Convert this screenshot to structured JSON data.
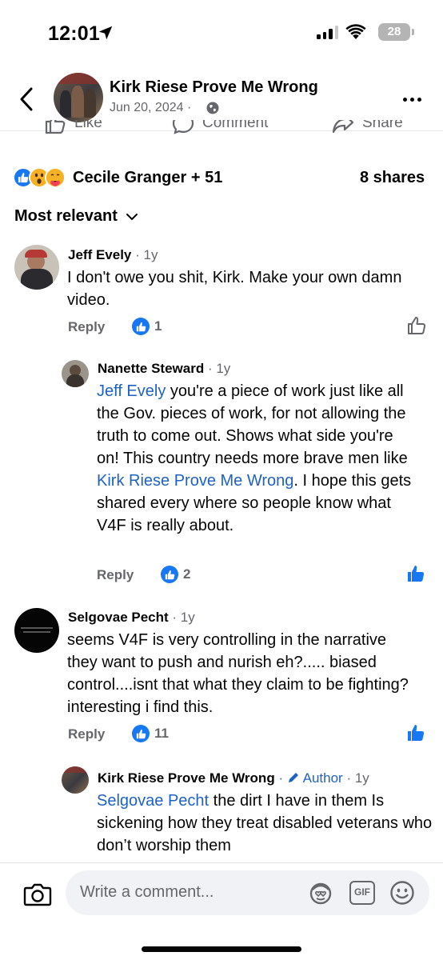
{
  "status": {
    "time": "12:01",
    "battery": "28"
  },
  "header": {
    "title": "Kirk Riese Prove Me Wrong",
    "date": "Jun 20, 2024",
    "date_separator": "·"
  },
  "actions": {
    "like": "Like",
    "comment": "Comment",
    "share": "Share"
  },
  "reactions": {
    "reactors": "Cecile Granger + 51",
    "shares": "8 shares"
  },
  "sort": {
    "label": "Most relevant"
  },
  "comments": [
    {
      "name": "Jeff Evely",
      "time": "· 1y",
      "text": "I don't owe you shit, Kirk. Make your own damn video.",
      "reply": "Reply",
      "likes": "1"
    },
    {
      "name": "Nanette Steward",
      "time": "· 1y",
      "mention1": "Jeff Evely",
      "text1": " you're a piece of work just like all the Gov. pieces of work,  for not allowing the truth to come out. Shows what side you're on! This country needs more brave men like ",
      "mention2": "Kirk Riese Prove Me Wrong",
      "text2": ". I hope this gets shared every where so people know what V4F is really about.",
      "reply": "Reply",
      "likes": "2"
    },
    {
      "name": "Selgovae Pecht",
      "time": "· 1y",
      "text": "seems V4F is very controlling in the narrative they want to push and nurish eh?..... biased control....isnt that what they claim to be fighting? interesting i find this.",
      "reply": "Reply",
      "likes": "11"
    },
    {
      "name": "Kirk Riese Prove Me Wrong",
      "author": "Author",
      "time": "· 1y",
      "mention1": "Selgovae Pecht",
      "text1": " the dirt I have in them Is sickening how they treat disabled veterans who don’t worship them"
    }
  ],
  "composer": {
    "placeholder": "Write a comment...",
    "gif": "GIF"
  }
}
